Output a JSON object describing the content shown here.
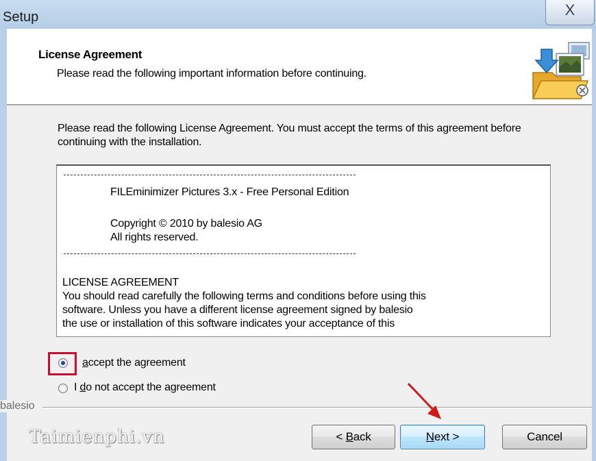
{
  "window": {
    "title": "Setup",
    "close_glyph": "X"
  },
  "header": {
    "title": "License Agreement",
    "subtitle": "Please read the following important information before continuing.",
    "icon": "installer-folder-icon"
  },
  "instructions": "Please read the following License Agreement. You must accept the terms of this agreement before continuing with the installation.",
  "license": {
    "product_line": "FILEminimizer Pictures 3.x - Free Personal Edition",
    "copyright_line": "Copyright © 2010 by balesio AG",
    "rights_line": "All rights reserved.",
    "heading": "LICENSE AGREEMENT",
    "body_lines": [
      "You should read carefully the following terms and conditions before using this",
      "software.  Unless you have a different license agreement signed by balesio",
      "the use or installation of this software indicates your acceptance of this"
    ],
    "scroll_up_glyph": "▲",
    "scroll_down_glyph": "▼"
  },
  "options": {
    "accept": {
      "prefix": "",
      "accel": "a",
      "rest": "ccept the agreement",
      "selected": true
    },
    "decline": {
      "prefix": "I ",
      "accel": "d",
      "rest": "o not accept the agreement",
      "selected": false
    }
  },
  "group_label": "balesio",
  "watermark": "Taimienphi.vn",
  "buttons": {
    "back": {
      "prefix": "< ",
      "accel": "B",
      "rest": "ack"
    },
    "next": {
      "prefix": "",
      "accel": "N",
      "rest": "ext >"
    },
    "cancel": "Cancel"
  },
  "colors": {
    "highlight_box": "#c8102e",
    "annotation_arrow": "#d0191b",
    "default_button_border": "#3c7fb1"
  }
}
